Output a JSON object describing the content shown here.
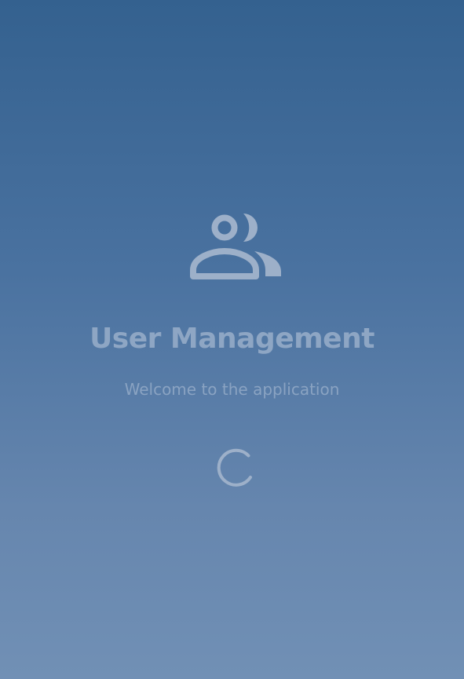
{
  "splash": {
    "icon": "people-icon",
    "title": "User Management",
    "subtitle": "Welcome to the application",
    "loading_indicator": "spinner"
  },
  "colors": {
    "background_top": "#34618f",
    "background_bottom": "#7190b5",
    "text": "#8ea6c4",
    "icon": "#9db0c9"
  }
}
